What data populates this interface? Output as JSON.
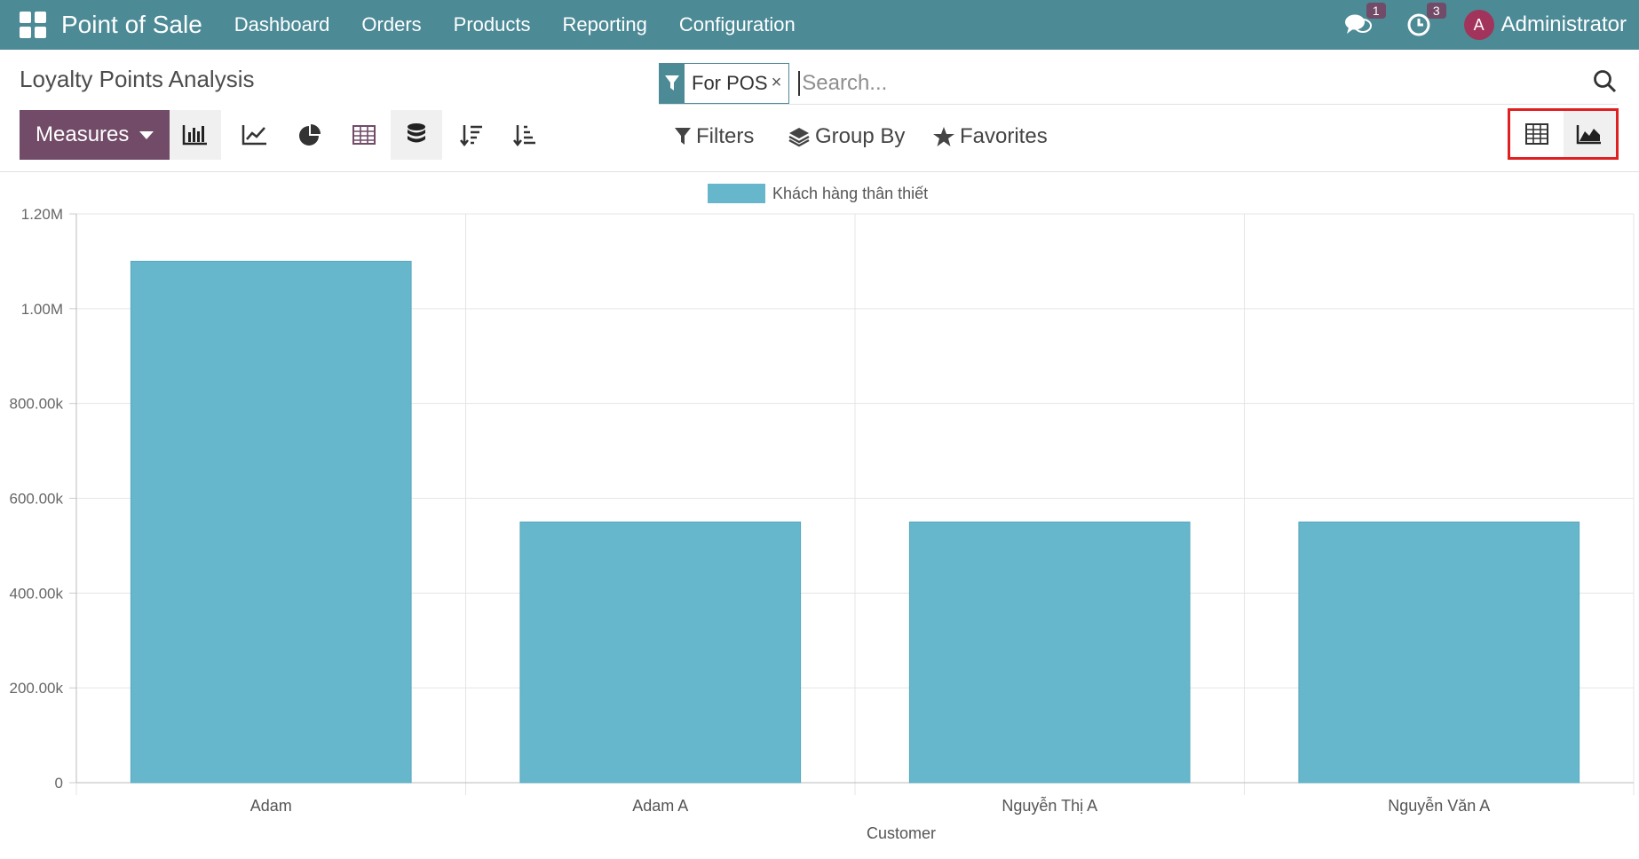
{
  "navbar": {
    "app_title": "Point of Sale",
    "menu": [
      "Dashboard",
      "Orders",
      "Products",
      "Reporting",
      "Configuration"
    ],
    "messages_badge": "1",
    "activities_badge": "3",
    "avatar_letter": "A",
    "user_name": "Administrator",
    "bg_color": "#4c8a96"
  },
  "control": {
    "page_title": "Loyalty Points Analysis",
    "facet_value": "For POS",
    "facet_remove": "×",
    "search_placeholder": "Search...",
    "measures_label": "Measures",
    "filters_label": "Filters",
    "group_by_label": "Group By",
    "favorites_label": "Favorites",
    "toolbar_icons": [
      "bar-chart-icon",
      "line-chart-icon",
      "pie-chart-icon",
      "table-icon",
      "stacked-icon",
      "sort-descending-icon",
      "sort-ascending-icon"
    ],
    "view_switcher": [
      "pivot-view-icon",
      "graph-view-icon"
    ],
    "accent_color": "#714b67"
  },
  "chart_data": {
    "type": "bar",
    "categories": [
      "Adam",
      "Adam A",
      "Nguyễn Thị A",
      "Nguyễn Văn A"
    ],
    "series": [
      {
        "name": "Khách hàng thân thiết",
        "values": [
          1100000,
          550000,
          550000,
          550000
        ],
        "color": "#67b7cc"
      }
    ],
    "xlabel": "Customer",
    "ylabel": "",
    "ylim": [
      0,
      1200000
    ],
    "yticks": [
      {
        "value": 0,
        "label": "0"
      },
      {
        "value": 200000,
        "label": "200.00k"
      },
      {
        "value": 400000,
        "label": "400.00k"
      },
      {
        "value": 600000,
        "label": "600.00k"
      },
      {
        "value": 800000,
        "label": "800.00k"
      },
      {
        "value": 1000000,
        "label": "1.00M"
      },
      {
        "value": 1200000,
        "label": "1.20M"
      }
    ],
    "grid": true,
    "legend": "top-center"
  }
}
